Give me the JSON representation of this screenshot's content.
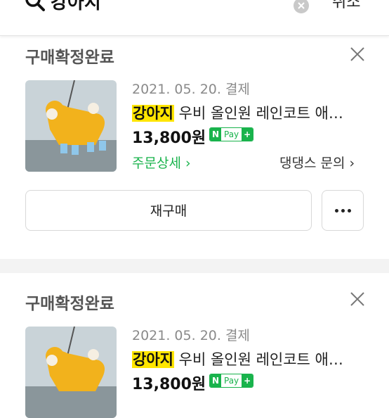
{
  "search": {
    "query": "강아지",
    "cancel_label": "취소"
  },
  "orders": [
    {
      "status": "구매확정완료",
      "date": "2021. 05. 20. 결제",
      "title_highlight": "강아지",
      "title_rest": " 우비 올인원 레인코트 애…",
      "price": "13,800원",
      "npay_label": "Pay",
      "order_detail_label": "주문상세 ›",
      "shop_inquiry_label": "댕댕스 문의 ›",
      "reorder_label": "재구매"
    },
    {
      "status": "구매확정완료",
      "date": "2021. 05. 20. 결제",
      "title_highlight": "강아지",
      "title_rest": " 우비 올인원 레인코트 애…",
      "price": "13,800원",
      "npay_label": "Pay"
    }
  ],
  "colors": {
    "accent_green": "#19b34c",
    "highlight_yellow": "#ffe600"
  }
}
